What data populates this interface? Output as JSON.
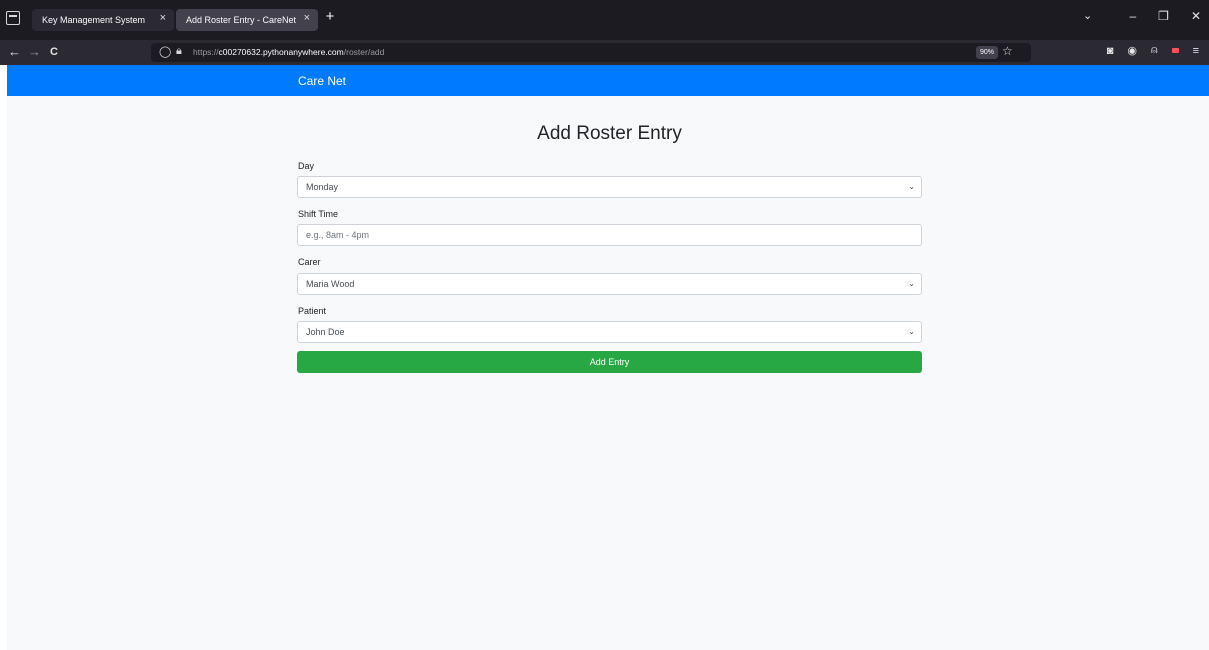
{
  "browser": {
    "tabs": [
      {
        "title": "Key Management System",
        "close": "×"
      },
      {
        "title": "Add Roster Entry - CareNet",
        "close": "×"
      }
    ],
    "new_tab": "+",
    "tab_overflow": "⌄",
    "window_controls": {
      "minimize": "–",
      "restore": "❐",
      "close": "✕"
    },
    "nav": {
      "back": "←",
      "forward": "→",
      "reload": "C"
    },
    "url": {
      "scheme": "https://",
      "host": "c00270632.pythonanywhere.com",
      "path": "/roster/add"
    },
    "zoom": "90%",
    "bookmark_star": "☆",
    "toolbar_icons": {
      "pocket": "◙",
      "account": "◉",
      "extensions": "⍝",
      "menu": "≡"
    }
  },
  "site": {
    "brand": "Care Net",
    "heading": "Add Roster Entry",
    "form": {
      "day": {
        "label": "Day",
        "value": "Monday"
      },
      "shift_time": {
        "label": "Shift Time",
        "placeholder": "e.g., 8am - 4pm"
      },
      "carer": {
        "label": "Carer",
        "value": "Maria Wood"
      },
      "patient": {
        "label": "Patient",
        "value": "John Doe"
      },
      "submit": "Add Entry"
    }
  },
  "icons": {
    "chevron": "⌄"
  },
  "colors": {
    "navbar": "#007bff",
    "submit": "#28a745",
    "page_bg": "#f8f9fa",
    "chrome_bg": "#1c1b22"
  }
}
